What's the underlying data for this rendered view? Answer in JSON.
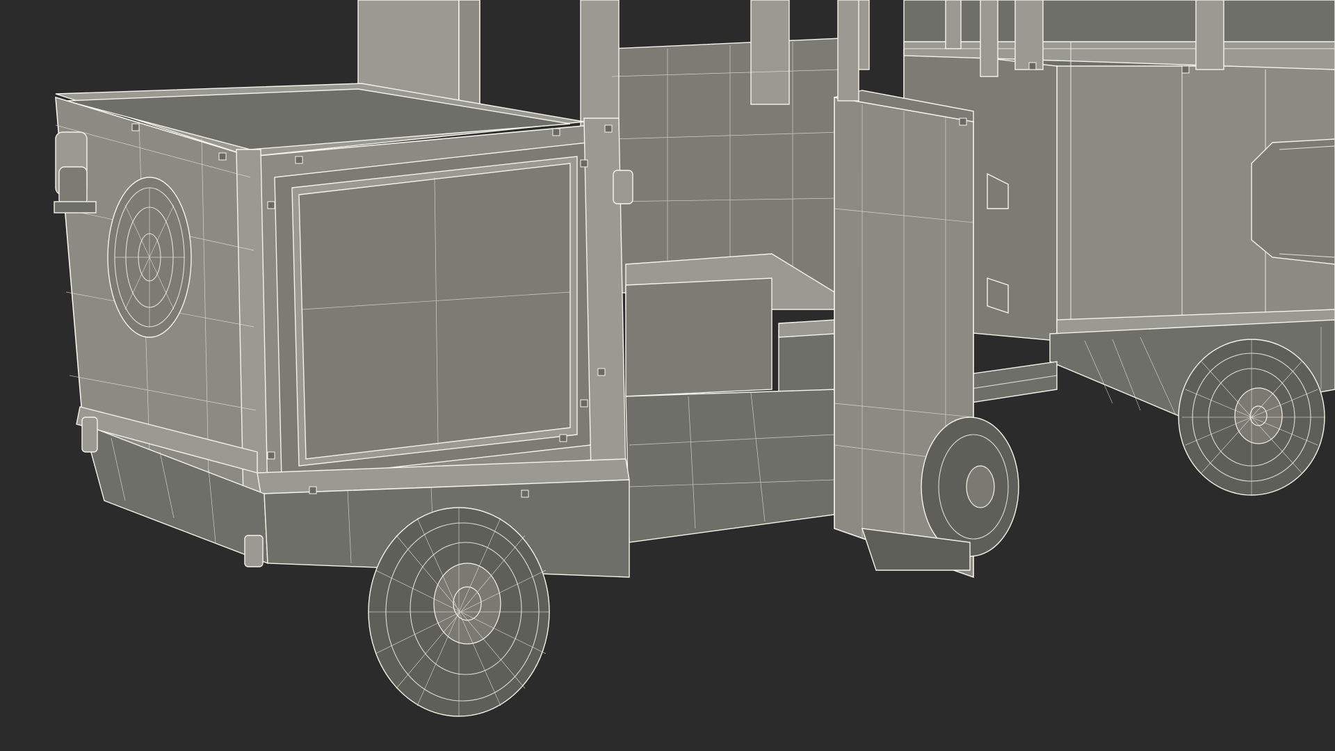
{
  "scene": {
    "background_color": "#2b2b2b",
    "wire_color": "#f4f4ea",
    "surface_color": "#8b8b83",
    "subject": "wireframe-3d-model"
  }
}
